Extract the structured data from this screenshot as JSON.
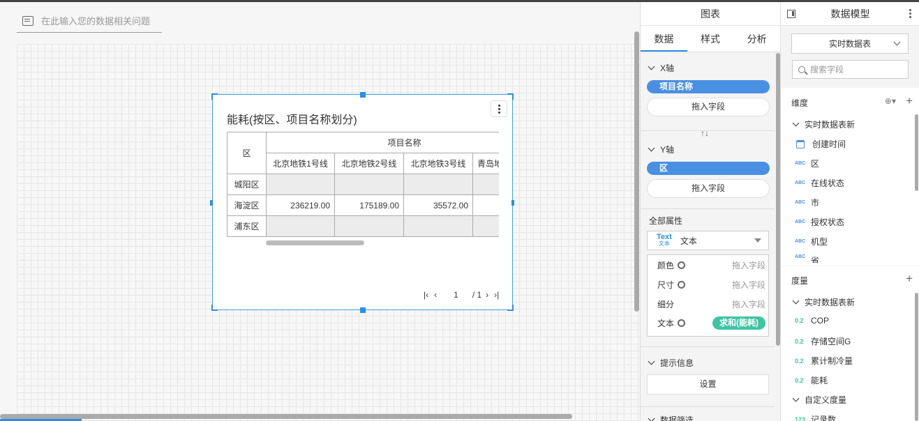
{
  "ask": {
    "placeholder": "在此输入您的数据相关问题"
  },
  "widget": {
    "title": "能耗(按区、项目名称划分)",
    "table": {
      "row_header": "区",
      "col_group": "项目名称",
      "columns": [
        "北京地铁1号线",
        "北京地铁2号线",
        "北京地铁3号线",
        "青岛地铁"
      ],
      "rows": [
        {
          "label": "城阳区",
          "values": [
            "",
            "",
            "",
            ""
          ]
        },
        {
          "label": "海淀区",
          "values": [
            "236219.00",
            "175189.00",
            "35572.00",
            ""
          ]
        },
        {
          "label": "浦东区",
          "values": [
            "",
            "",
            "",
            ""
          ]
        }
      ]
    },
    "pager": {
      "current": "1",
      "total": "/ 1"
    }
  },
  "config": {
    "title": "图表",
    "tabs": [
      "数据",
      "样式",
      "分析"
    ],
    "x_axis": {
      "label": "X轴",
      "field": "项目名称",
      "drop": "拖入字段"
    },
    "y_axis": {
      "label": "Y轴",
      "field": "区",
      "drop": "拖入字段"
    },
    "all_props": {
      "label": "全部属性",
      "type_icon": "Text",
      "type_icon_sub": "文本",
      "type_label": "文本"
    },
    "props": [
      {
        "label": "颜色",
        "value": "拖入字段"
      },
      {
        "label": "尺寸",
        "value": "拖入字段"
      },
      {
        "label": "细分",
        "value": "拖入字段"
      },
      {
        "label": "文本",
        "value": "求和(能耗)"
      }
    ],
    "tooltip": {
      "label": "提示信息",
      "button": "设置"
    },
    "filter": {
      "label": "数据筛选"
    }
  },
  "model": {
    "title": "数据模型",
    "dataset": "实时数据表",
    "search_placeholder": "搜索字段",
    "dimensions": {
      "label": "维度",
      "group": "实时数据表新",
      "fields": [
        {
          "type": "date",
          "name": "创建时间"
        },
        {
          "type": "ABC",
          "name": "区"
        },
        {
          "type": "ABC",
          "name": "在线状态"
        },
        {
          "type": "ABC",
          "name": "市"
        },
        {
          "type": "ABC",
          "name": "授权状态"
        },
        {
          "type": "ABC",
          "name": "机型"
        },
        {
          "type": "ABC",
          "name": "省"
        }
      ]
    },
    "measures": {
      "label": "度量",
      "group": "实时数据表新",
      "fields": [
        {
          "type": "0.2",
          "name": "COP"
        },
        {
          "type": "0.2",
          "name": "存储空间G"
        },
        {
          "type": "0.2",
          "name": "累计制冷量"
        },
        {
          "type": "0.2",
          "name": "能耗"
        }
      ],
      "custom_group": "自定义度量",
      "custom_fields": [
        {
          "type": "123",
          "name": "记录数"
        }
      ]
    }
  }
}
